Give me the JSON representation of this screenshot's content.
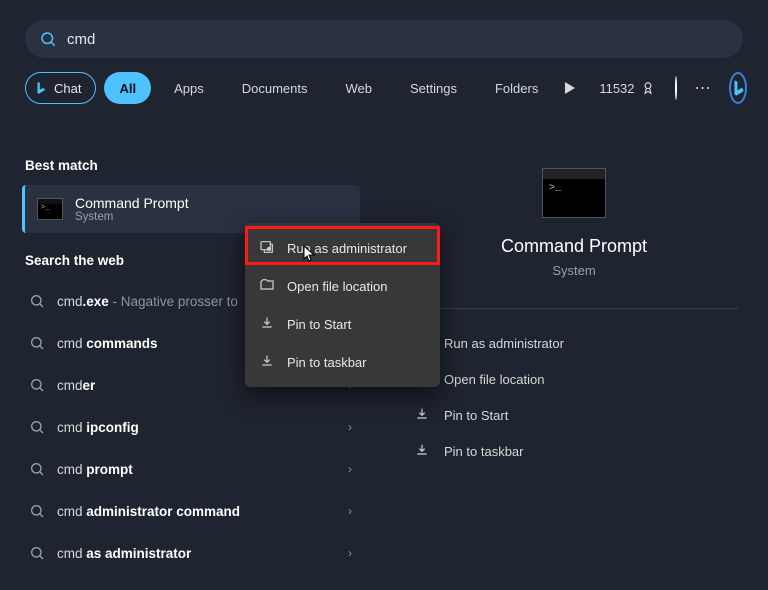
{
  "search": {
    "query": "cmd"
  },
  "filters": [
    "Chat",
    "All",
    "Apps",
    "Documents",
    "Web",
    "Settings",
    "Folders"
  ],
  "points": "11532",
  "best_match_label": "Best match",
  "best_match": {
    "title": "Command Prompt",
    "subtitle": "System"
  },
  "search_web_label": "Search the web",
  "web_results": [
    {
      "prefix": "cmd",
      "bold": ".exe",
      "desc": " - Nagative prosser to"
    },
    {
      "prefix": "cmd ",
      "bold": "commands",
      "desc": ""
    },
    {
      "prefix": "cmd",
      "bold": "er",
      "desc": ""
    },
    {
      "prefix": "cmd ",
      "bold": "ipconfig",
      "desc": ""
    },
    {
      "prefix": "cmd ",
      "bold": "prompt",
      "desc": ""
    },
    {
      "prefix": "cmd ",
      "bold": "administrator command",
      "desc": ""
    },
    {
      "prefix": "cmd ",
      "bold": "as administrator",
      "desc": ""
    }
  ],
  "preview": {
    "title": "Command Prompt",
    "subtitle": "System"
  },
  "preview_actions": [
    "Run as administrator",
    "Open file location",
    "Pin to Start",
    "Pin to taskbar"
  ],
  "context_menu": [
    "Run as administrator",
    "Open file location",
    "Pin to Start",
    "Pin to taskbar"
  ]
}
